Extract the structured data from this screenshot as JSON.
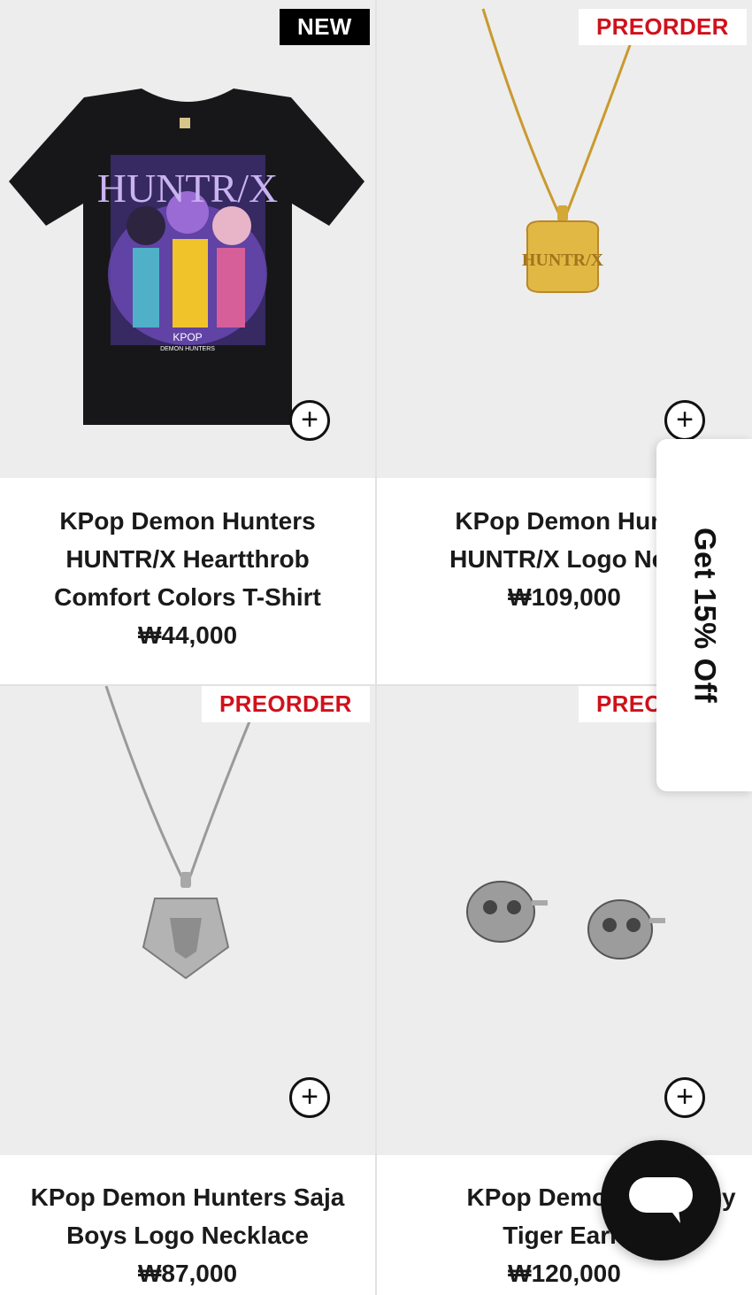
{
  "products": [
    {
      "name_lines": [
        "KPop Demon Hunters",
        "HUNTR/X Heartthrob",
        "Comfort Colors T-Shirt"
      ],
      "price": "₩44,000",
      "badge": "NEW",
      "shirt_title": "HUNTR/X",
      "shirt_logo_1": "KPOP",
      "shirt_logo_2": "DEMON HUNTERS"
    },
    {
      "name_lines": [
        "KPop Demon Hunt",
        "HUNTR/X Logo Nec"
      ],
      "price": "₩109,000",
      "badge": "PREORDER",
      "pendant_text": "HUNTR/X"
    },
    {
      "name_lines": [
        "KPop Demon Hunters Saja",
        "Boys Logo Necklace"
      ],
      "price": "₩87,000",
      "badge": "PREORDER"
    },
    {
      "name_lines": [
        "KPop Demon Hu",
        "Tiger Earri"
      ],
      "name_tail": "y",
      "price": "₩120,000",
      "badge": "PREC"
    }
  ],
  "promo": {
    "label": "Get 15% Off"
  },
  "add_button": {
    "symbol": "+"
  },
  "colors": {
    "badge_red": "#d0111b",
    "badge_black": "#000000",
    "card_bg": "#ededed",
    "text": "#1a1a1a"
  }
}
